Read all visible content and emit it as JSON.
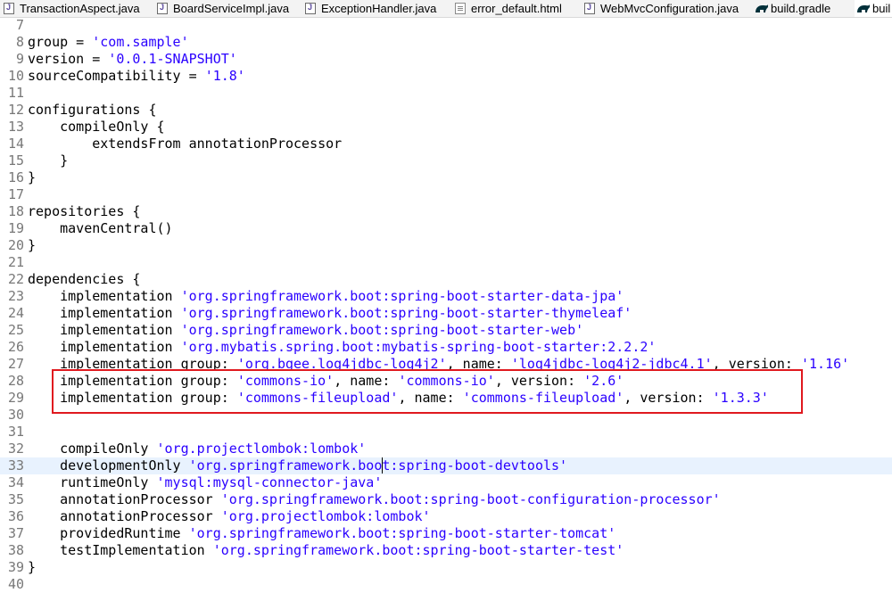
{
  "tabs": [
    {
      "label": "TransactionAspect.java",
      "icon": "java-file-icon"
    },
    {
      "label": "BoardServiceImpl.java",
      "icon": "java-file-icon"
    },
    {
      "label": "ExceptionHandler.java",
      "icon": "java-file-icon"
    },
    {
      "label": "error_default.html",
      "icon": "html-file-icon"
    },
    {
      "label": "WebMvcConfiguration.java",
      "icon": "java-file-icon"
    },
    {
      "label": "build.gradle",
      "icon": "gradle-icon"
    },
    {
      "label": "buil",
      "icon": "gradle-icon"
    }
  ],
  "editor": {
    "current_line": "33",
    "colors": {
      "string": "#2a00ff",
      "line_number": "#787878",
      "highlight_border": "#e0191f",
      "current_line_bg": "#e8f2fe"
    },
    "lines": [
      {
        "n": "7",
        "segs": [
          {
            "t": ""
          }
        ]
      },
      {
        "n": "8",
        "segs": [
          {
            "t": "group = "
          },
          {
            "t": "'com.sample'",
            "s": 1
          }
        ]
      },
      {
        "n": "9",
        "segs": [
          {
            "t": "version = "
          },
          {
            "t": "'0.0.1-SNAPSHOT'",
            "s": 1
          }
        ]
      },
      {
        "n": "10",
        "segs": [
          {
            "t": "sourceCompatibility = "
          },
          {
            "t": "'1.8'",
            "s": 1
          }
        ]
      },
      {
        "n": "11",
        "segs": [
          {
            "t": ""
          }
        ]
      },
      {
        "n": "12",
        "segs": [
          {
            "t": "configurations {"
          }
        ]
      },
      {
        "n": "13",
        "segs": [
          {
            "t": "    compileOnly {"
          }
        ]
      },
      {
        "n": "14",
        "segs": [
          {
            "t": "        extendsFrom annotationProcessor"
          }
        ]
      },
      {
        "n": "15",
        "segs": [
          {
            "t": "    }"
          }
        ]
      },
      {
        "n": "16",
        "segs": [
          {
            "t": "}"
          }
        ]
      },
      {
        "n": "17",
        "segs": [
          {
            "t": ""
          }
        ]
      },
      {
        "n": "18",
        "segs": [
          {
            "t": "repositories {"
          }
        ]
      },
      {
        "n": "19",
        "segs": [
          {
            "t": "    mavenCentral()"
          }
        ]
      },
      {
        "n": "20",
        "segs": [
          {
            "t": "}"
          }
        ]
      },
      {
        "n": "21",
        "segs": [
          {
            "t": ""
          }
        ]
      },
      {
        "n": "22",
        "segs": [
          {
            "t": "dependencies {"
          }
        ]
      },
      {
        "n": "23",
        "segs": [
          {
            "t": "    implementation "
          },
          {
            "t": "'org.springframework.boot:spring-boot-starter-data-jpa'",
            "s": 1
          }
        ]
      },
      {
        "n": "24",
        "segs": [
          {
            "t": "    implementation "
          },
          {
            "t": "'org.springframework.boot:spring-boot-starter-thymeleaf'",
            "s": 1
          }
        ]
      },
      {
        "n": "25",
        "segs": [
          {
            "t": "    implementation "
          },
          {
            "t": "'org.springframework.boot:spring-boot-starter-web'",
            "s": 1
          }
        ]
      },
      {
        "n": "26",
        "segs": [
          {
            "t": "    implementation "
          },
          {
            "t": "'org.mybatis.spring.boot:mybatis-spring-boot-starter:2.2.2'",
            "s": 1
          }
        ]
      },
      {
        "n": "27",
        "segs": [
          {
            "t": "    implementation group: "
          },
          {
            "t": "'org.bgee.log4jdbc-log4j2'",
            "s": 1
          },
          {
            "t": ", name: "
          },
          {
            "t": "'log4jdbc-log4j2-jdbc4.1'",
            "s": 1
          },
          {
            "t": ", version: "
          },
          {
            "t": "'1.16'",
            "s": 1
          }
        ]
      },
      {
        "n": "28",
        "segs": [
          {
            "t": "    implementation group: "
          },
          {
            "t": "'commons-io'",
            "s": 1
          },
          {
            "t": ", name: "
          },
          {
            "t": "'commons-io'",
            "s": 1
          },
          {
            "t": ", version: "
          },
          {
            "t": "'2.6'",
            "s": 1
          }
        ]
      },
      {
        "n": "29",
        "segs": [
          {
            "t": "    implementation group: "
          },
          {
            "t": "'commons-fileupload'",
            "s": 1
          },
          {
            "t": ", name: "
          },
          {
            "t": "'commons-fileupload'",
            "s": 1
          },
          {
            "t": ", version: "
          },
          {
            "t": "'1.3.3'",
            "s": 1
          }
        ]
      },
      {
        "n": "30",
        "segs": [
          {
            "t": ""
          }
        ]
      },
      {
        "n": "31",
        "segs": [
          {
            "t": ""
          }
        ]
      },
      {
        "n": "32",
        "segs": [
          {
            "t": "    compileOnly "
          },
          {
            "t": "'org.projectlombok:lombok'",
            "s": 1
          }
        ]
      },
      {
        "n": "33",
        "segs": [
          {
            "t": "    developmentOnly "
          },
          {
            "t": "'org.springframework.boot:spring-boot-devtools'",
            "s": 1
          }
        ]
      },
      {
        "n": "34",
        "segs": [
          {
            "t": "    runtimeOnly "
          },
          {
            "t": "'mysql:mysql-connector-java'",
            "s": 1
          }
        ]
      },
      {
        "n": "35",
        "segs": [
          {
            "t": "    annotationProcessor "
          },
          {
            "t": "'org.springframework.boot:spring-boot-configuration-processor'",
            "s": 1
          }
        ]
      },
      {
        "n": "36",
        "segs": [
          {
            "t": "    annotationProcessor "
          },
          {
            "t": "'org.projectlombok:lombok'",
            "s": 1
          }
        ]
      },
      {
        "n": "37",
        "segs": [
          {
            "t": "    providedRuntime "
          },
          {
            "t": "'org.springframework.boot:spring-boot-starter-tomcat'",
            "s": 1
          }
        ]
      },
      {
        "n": "38",
        "segs": [
          {
            "t": "    testImplementation "
          },
          {
            "t": "'org.springframework.boot:spring-boot-starter-test'",
            "s": 1
          }
        ]
      },
      {
        "n": "39",
        "segs": [
          {
            "t": "}"
          }
        ]
      },
      {
        "n": "40",
        "segs": [
          {
            "t": ""
          }
        ]
      }
    ]
  }
}
